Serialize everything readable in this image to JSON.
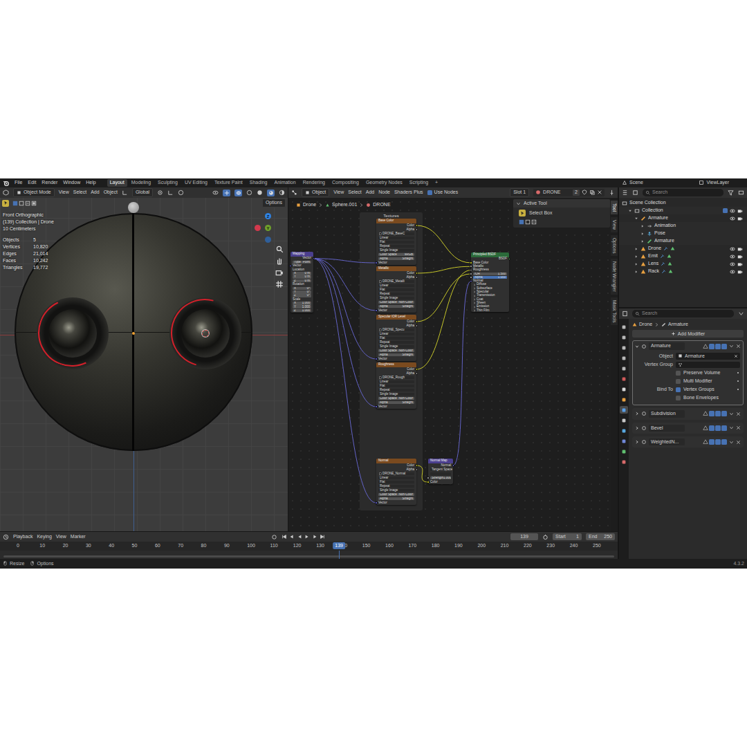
{
  "menubar": {
    "menus": [
      "File",
      "Edit",
      "Render",
      "Window",
      "Help"
    ],
    "workspaces": [
      {
        "label": "Layout",
        "selected": true
      },
      {
        "label": "Modeling",
        "selected": false
      },
      {
        "label": "Sculpting",
        "selected": false
      },
      {
        "label": "UV Editing",
        "selected": false
      },
      {
        "label": "Texture Paint",
        "selected": false
      },
      {
        "label": "Shading",
        "selected": false
      },
      {
        "label": "Animation",
        "selected": false
      },
      {
        "label": "Rendering",
        "selected": false
      },
      {
        "label": "Compositing",
        "selected": false
      },
      {
        "label": "Geometry Nodes",
        "selected": false
      },
      {
        "label": "Scripting",
        "selected": false
      }
    ],
    "add_workspace": "+",
    "scene": "Scene",
    "view_layer": "ViewLayer"
  },
  "viewport": {
    "header": {
      "mode": "Object Mode",
      "menus": [
        "View",
        "Select",
        "Add",
        "Object"
      ],
      "orientation": "Global"
    },
    "options": "Options",
    "overlay": [
      "Front Orthographic",
      "(139) Collection | Drone",
      "10 Centimeters"
    ],
    "stats": [
      {
        "label": "Objects",
        "value": "5"
      },
      {
        "label": "Vertices",
        "value": "10,820"
      },
      {
        "label": "Edges",
        "value": "21,014"
      },
      {
        "label": "Faces",
        "value": "10,242"
      },
      {
        "label": "Triangles",
        "value": "19,772"
      }
    ],
    "gizmo": [
      {
        "label": "Z",
        "color": "#2f83e3"
      },
      {
        "label": "",
        "color": "#d2394d"
      },
      {
        "label": "Y",
        "color": "#6fa12b"
      },
      {
        "label": "",
        "color": "#2f5f9a"
      }
    ]
  },
  "node_editor": {
    "header": {
      "editor": "Object",
      "menus": [
        "View",
        "Select",
        "Add",
        "Node",
        "Shaders Plus"
      ],
      "use_nodes": {
        "label": "Use Nodes",
        "checked": true
      },
      "slot": "Slot 1",
      "material": "DRONE",
      "users": "2"
    },
    "breadcrumb": [
      "Drone",
      "Sphere.001",
      "DRONE"
    ],
    "frame": "Textures",
    "nodes": [
      {
        "title": "Mapping",
        "kind": "vector",
        "rows": [
          {
            "kind": "output",
            "label": "Vector",
            "socket": "vector"
          },
          {
            "kind": "field",
            "label": "Type",
            "value": "Point"
          },
          {
            "kind": "input",
            "label": "Vector",
            "socket": "vector"
          },
          {
            "kind": "text",
            "label": "Location"
          },
          {
            "kind": "field",
            "label": "X",
            "value": "0 m"
          },
          {
            "kind": "field",
            "label": "Y",
            "value": "0 m"
          },
          {
            "kind": "field",
            "label": "Z",
            "value": "0 m"
          },
          {
            "kind": "text",
            "label": "Rotation"
          },
          {
            "kind": "field",
            "label": "X",
            "value": "0°"
          },
          {
            "kind": "field",
            "label": "Y",
            "value": "0°"
          },
          {
            "kind": "field",
            "label": "Z",
            "value": "0°"
          },
          {
            "kind": "text",
            "label": "Scale"
          },
          {
            "kind": "field",
            "label": "X",
            "value": "1.000"
          },
          {
            "kind": "field",
            "label": "Y",
            "value": "1.000"
          },
          {
            "kind": "field",
            "label": "Z",
            "value": "1.000"
          }
        ]
      },
      {
        "title": "Base Color",
        "kind": "texture",
        "rows": [
          {
            "kind": "output",
            "label": "Color",
            "socket": "color"
          },
          {
            "kind": "output",
            "label": "Alpha",
            "socket": "float"
          },
          {
            "kind": "image",
            "label": "DRONE_BaseC"
          },
          {
            "kind": "dropdown",
            "label": "Linear"
          },
          {
            "kind": "dropdown",
            "label": "Flat"
          },
          {
            "kind": "dropdown",
            "label": "Repeat"
          },
          {
            "kind": "dropdown",
            "label": "Single Image"
          },
          {
            "kind": "field",
            "label": "Color Space",
            "value": "sRGB"
          },
          {
            "kind": "field",
            "label": "Alpha",
            "value": "Straight"
          },
          {
            "kind": "input",
            "label": "Vector",
            "socket": "vector"
          }
        ]
      },
      {
        "title": "Metallic",
        "kind": "texture",
        "rows": [
          {
            "kind": "output",
            "label": "Color",
            "socket": "color"
          },
          {
            "kind": "output",
            "label": "Alpha",
            "socket": "float"
          },
          {
            "kind": "image",
            "label": "DRONE_Metalli"
          },
          {
            "kind": "dropdown",
            "label": "Linear"
          },
          {
            "kind": "dropdown",
            "label": "Flat"
          },
          {
            "kind": "dropdown",
            "label": "Repeat"
          },
          {
            "kind": "dropdown",
            "label": "Single Image"
          },
          {
            "kind": "field",
            "label": "Color Space",
            "value": "Non-Color"
          },
          {
            "kind": "field",
            "label": "Alpha",
            "value": "Straight"
          },
          {
            "kind": "input",
            "label": "Vector",
            "socket": "vector"
          }
        ]
      },
      {
        "title": "Specular IOR Level",
        "kind": "texture",
        "rows": [
          {
            "kind": "output",
            "label": "Color",
            "socket": "color"
          },
          {
            "kind": "output",
            "label": "Alpha",
            "socket": "float"
          },
          {
            "kind": "image",
            "label": "DRONE_Specu"
          },
          {
            "kind": "dropdown",
            "label": "Linear"
          },
          {
            "kind": "dropdown",
            "label": "Flat"
          },
          {
            "kind": "dropdown",
            "label": "Repeat"
          },
          {
            "kind": "dropdown",
            "label": "Single Image"
          },
          {
            "kind": "field",
            "label": "Color Space",
            "value": "Non-Color"
          },
          {
            "kind": "field",
            "label": "Alpha",
            "value": "Straight"
          },
          {
            "kind": "input",
            "label": "Vector",
            "socket": "vector"
          }
        ]
      },
      {
        "title": "Roughness",
        "kind": "texture",
        "rows": [
          {
            "kind": "output",
            "label": "Color",
            "socket": "color"
          },
          {
            "kind": "output",
            "label": "Alpha",
            "socket": "float"
          },
          {
            "kind": "image",
            "label": "DRONE_Rough"
          },
          {
            "kind": "dropdown",
            "label": "Linear"
          },
          {
            "kind": "dropdown",
            "label": "Flat"
          },
          {
            "kind": "dropdown",
            "label": "Repeat"
          },
          {
            "kind": "dropdown",
            "label": "Single Image"
          },
          {
            "kind": "field",
            "label": "Color Space",
            "value": "Non-Color"
          },
          {
            "kind": "field",
            "label": "Alpha",
            "value": "Straight"
          },
          {
            "kind": "input",
            "label": "Vector",
            "socket": "vector"
          }
        ]
      },
      {
        "title": "Normal",
        "kind": "texture",
        "rows": [
          {
            "kind": "output",
            "label": "Color",
            "socket": "color"
          },
          {
            "kind": "output",
            "label": "Alpha",
            "socket": "float"
          },
          {
            "kind": "image",
            "label": "DRONE_Normal"
          },
          {
            "kind": "dropdown",
            "label": "Linear"
          },
          {
            "kind": "dropdown",
            "label": "Flat"
          },
          {
            "kind": "dropdown",
            "label": "Repeat"
          },
          {
            "kind": "dropdown",
            "label": "Single Image"
          },
          {
            "kind": "field",
            "label": "Color Space",
            "value": "Non-Color"
          },
          {
            "kind": "field",
            "label": "Alpha",
            "value": "Straight"
          },
          {
            "kind": "input",
            "label": "Vector",
            "socket": "vector"
          }
        ]
      },
      {
        "title": "Principled BSDF",
        "kind": "shader",
        "rows": [
          {
            "kind": "output",
            "label": "BSDF",
            "socket": "shader"
          },
          {
            "kind": "input",
            "label": "Base Color",
            "socket": "color"
          },
          {
            "kind": "input",
            "label": "Metallic",
            "socket": "float"
          },
          {
            "kind": "input",
            "label": "Roughness",
            "socket": "float"
          },
          {
            "kind": "field",
            "label": "IOR",
            "value": "1.500",
            "socket": "float"
          },
          {
            "kind": "slider",
            "label": "Alpha",
            "value": "1.000",
            "level": 1.0,
            "socket": "float"
          },
          {
            "kind": "input",
            "label": "Normal",
            "socket": "vector"
          },
          {
            "kind": "panel",
            "label": "Diffuse"
          },
          {
            "kind": "panel",
            "label": "Subsurface"
          },
          {
            "kind": "panel",
            "label": "Specular"
          },
          {
            "kind": "panel",
            "label": "Transmission"
          },
          {
            "kind": "panel",
            "label": "Coat"
          },
          {
            "kind": "panel",
            "label": "Sheen"
          },
          {
            "kind": "panel",
            "label": "Emission"
          },
          {
            "kind": "panel",
            "label": "Thin Film"
          }
        ]
      },
      {
        "title": "Normal Map",
        "kind": "vector",
        "rows": [
          {
            "kind": "output",
            "label": "Normal",
            "socket": "vector"
          },
          {
            "kind": "dropdown",
            "label": "Tangent Space"
          },
          {
            "kind": "dropdown",
            "label": ""
          },
          {
            "kind": "field",
            "label": "Strength",
            "value": "1.000",
            "socket": "float"
          },
          {
            "kind": "input",
            "label": "Color",
            "socket": "color"
          }
        ]
      }
    ],
    "sidebar": {
      "panel": "Active Tool",
      "tool": "Select Box"
    },
    "tabs": [
      {
        "label": "Tool",
        "selected": true
      },
      {
        "label": "View",
        "selected": false
      },
      {
        "label": "Options",
        "selected": false
      },
      {
        "label": "Node Wrangler",
        "selected": false
      },
      {
        "label": "Mask Tools",
        "selected": false
      }
    ]
  },
  "outliner": {
    "search": "Search",
    "rows": [
      {
        "label": "Scene Collection",
        "depth": 0,
        "kind": "scene",
        "expanded": true,
        "toggles": false
      },
      {
        "label": "Collection",
        "depth": 1,
        "kind": "collection",
        "expanded": true,
        "toggles": true
      },
      {
        "label": "Armature",
        "depth": 2,
        "kind": "armature",
        "expanded": true,
        "toggles": true
      },
      {
        "label": "Animation",
        "depth": 3,
        "kind": "action",
        "expanded": false,
        "toggles": false
      },
      {
        "label": "Pose",
        "depth": 3,
        "kind": "pose",
        "expanded": false,
        "toggles": false
      },
      {
        "label": "Armature",
        "depth": 3,
        "kind": "armature-data",
        "expanded": false,
        "toggles": false
      },
      {
        "label": "Drone",
        "depth": 2,
        "kind": "mesh",
        "expanded": false,
        "toggles": true
      },
      {
        "label": "Emit",
        "depth": 2,
        "kind": "mesh",
        "expanded": false,
        "toggles": true
      },
      {
        "label": "Lens",
        "depth": 2,
        "kind": "mesh",
        "expanded": false,
        "toggles": true
      },
      {
        "label": "Rack",
        "depth": 2,
        "kind": "mesh",
        "expanded": false,
        "toggles": true
      }
    ]
  },
  "properties": {
    "search": "Search",
    "tabs": [
      {
        "kind": "tool",
        "selected": false
      },
      {
        "kind": "render",
        "selected": false
      },
      {
        "kind": "output",
        "selected": false
      },
      {
        "kind": "view_layer",
        "selected": false
      },
      {
        "kind": "scene",
        "selected": false
      },
      {
        "kind": "world",
        "selected": false
      },
      {
        "kind": "collection",
        "selected": false
      },
      {
        "kind": "object",
        "selected": false
      },
      {
        "kind": "modifiers",
        "selected": true
      },
      {
        "kind": "particles",
        "selected": false
      },
      {
        "kind": "physics",
        "selected": false
      },
      {
        "kind": "constraints",
        "selected": false
      },
      {
        "kind": "data",
        "selected": false
      },
      {
        "kind": "material",
        "selected": false
      }
    ],
    "breadcrumb": [
      "Drone",
      "Armature"
    ],
    "add_modifier": "Add Modifier",
    "modifiers": [
      {
        "name": "Armature",
        "expanded": true
      },
      {
        "name": "Subdivision",
        "expanded": false
      },
      {
        "name": "Bevel",
        "expanded": false
      },
      {
        "name": "WeightedN...",
        "expanded": false
      }
    ],
    "armature": {
      "object": {
        "label": "Object",
        "value": "Armature"
      },
      "vertex_group": {
        "label": "Vertex Group",
        "value": ""
      },
      "options": [
        {
          "label": "Preserve Volume",
          "checked": false
        },
        {
          "label": "Multi Modifier",
          "checked": false
        }
      ],
      "bind_to": {
        "label": "Bind To",
        "options": [
          {
            "label": "Vertex Groups",
            "checked": true
          },
          {
            "label": "Bone Envelopes",
            "checked": false
          }
        ]
      }
    }
  },
  "timeline": {
    "menus": [
      "Playback",
      "Keying",
      "View",
      "Marker"
    ],
    "frame": "139",
    "start": {
      "label": "Start",
      "value": "1"
    },
    "end": {
      "label": "End",
      "value": "250"
    },
    "ticks": [
      "0",
      "10",
      "20",
      "30",
      "40",
      "50",
      "60",
      "70",
      "80",
      "90",
      "100",
      "110",
      "120",
      "130",
      "140",
      "150",
      "160",
      "170",
      "180",
      "190",
      "200",
      "210",
      "220",
      "230",
      "240",
      "250"
    ],
    "playhead": {
      "label": "139",
      "level": 0.556
    }
  },
  "status_bar": {
    "items": [
      "Resize",
      "Options"
    ],
    "version": "4.3.2"
  }
}
